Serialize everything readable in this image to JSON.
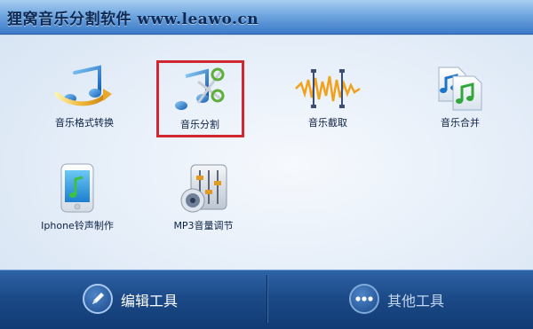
{
  "window": {
    "title": "狸窝音乐分割软件 www.leawo.cn"
  },
  "tools": [
    {
      "label": "音乐格式转换",
      "icon": "music-note-arrow-icon"
    },
    {
      "label": "音乐分割",
      "icon": "music-note-scissors-icon",
      "selected": true
    },
    {
      "label": "音乐截取",
      "icon": "waveform-cut-icon"
    },
    {
      "label": "音乐合并",
      "icon": "music-files-merge-icon"
    },
    {
      "label": "Iphone铃声制作",
      "icon": "phone-ringtone-icon"
    },
    {
      "label": "MP3音量调节",
      "icon": "volume-mixer-icon"
    }
  ],
  "bottom": {
    "edit_tools": {
      "label": "编辑工具",
      "icon": "pencil-icon"
    },
    "other_tools": {
      "label": "其他工具",
      "icon": "more-dots-icon"
    }
  },
  "colors": {
    "highlight": "#d02730",
    "titlebar": "#4a86cf",
    "bottombar": "#1c4a88"
  }
}
